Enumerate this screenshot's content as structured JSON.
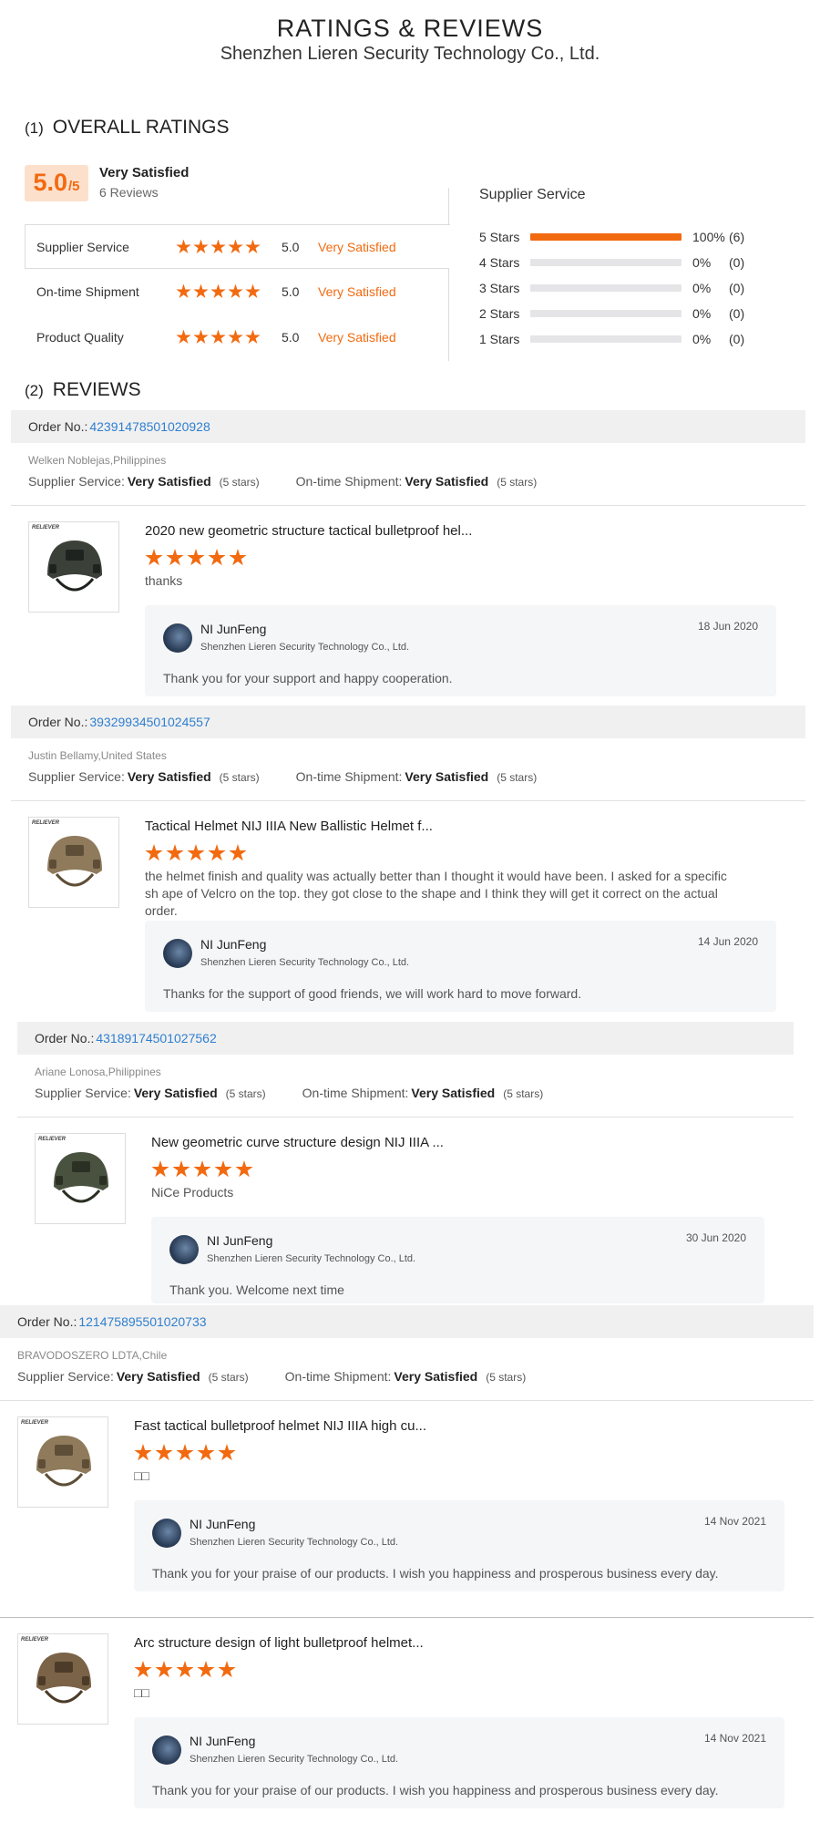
{
  "page": {
    "title": "RATINGS & REVIEWS",
    "company": "Shenzhen Lieren Security Technology Co., Ltd."
  },
  "overall": {
    "section_num": "(1)",
    "section_label": "OVERALL RATINGS",
    "score": "5.0",
    "score_max": "/5",
    "label": "Very Satisfied",
    "review_count": "6 Reviews",
    "categories": [
      {
        "name": "Supplier Service",
        "stars": 5,
        "value": "5.0",
        "label": "Very Satisfied"
      },
      {
        "name": "On-time Shipment",
        "stars": 5,
        "value": "5.0",
        "label": "Very Satisfied"
      },
      {
        "name": "Product Quality",
        "stars": 5,
        "value": "5.0",
        "label": "Very Satisfied"
      }
    ],
    "distribution_title": "Supplier Service",
    "distribution": [
      {
        "label": "5  Stars",
        "percent": 100,
        "percent_text": "100%",
        "count": "(6)"
      },
      {
        "label": "4  Stars",
        "percent": 0,
        "percent_text": "0%",
        "count": "(0)"
      },
      {
        "label": "3  Stars",
        "percent": 0,
        "percent_text": "0%",
        "count": "(0)"
      },
      {
        "label": "2  Stars",
        "percent": 0,
        "percent_text": "0%",
        "count": "(0)"
      },
      {
        "label": "1  Stars",
        "percent": 0,
        "percent_text": "0%",
        "count": "(0)"
      }
    ],
    "accent_color": "#f26a10"
  },
  "reviews_section": {
    "section_num": "(2)",
    "section_label": "REVIEWS"
  },
  "labels": {
    "order_no": "Order No.:",
    "supplier_service": "Supplier Service:",
    "ontime_shipment": "On-time Shipment:",
    "very_satisfied": "Very Satisfied",
    "five_stars": "(5 stars)"
  },
  "orders": [
    {
      "order_number": "42391478501020928",
      "buyer": "Welken Noblejas,Philippines",
      "reviews": [
        {
          "product_title": "2020 new geometric structure tactical bulletproof hel...",
          "stars": 5,
          "comment": "thanks",
          "thumb_icon": "helmet-black-icon",
          "reply": {
            "name": "NI JunFeng",
            "company": "Shenzhen Lieren Security Technology Co., Ltd.",
            "date": "18 Jun 2020",
            "text": "Thank you for your support and happy cooperation."
          }
        }
      ]
    },
    {
      "order_number": "39329934501024557",
      "buyer": "Justin Bellamy,United States",
      "reviews": [
        {
          "product_title": "Tactical Helmet NIJ IIIA New Ballistic Helmet f...",
          "stars": 5,
          "comment": "the helmet finish and quality was actually better than I thought it would have been. I asked for a specific sh ape of Velcro on the top. they got close to the shape and I think they will get it correct on the actual order.",
          "thumb_icon": "helmet-tan-icon",
          "reply": {
            "name": "NI JunFeng",
            "company": "Shenzhen Lieren Security Technology Co., Ltd.",
            "date": "14 Jun 2020",
            "text": "Thanks for the support of good friends, we will work hard to move forward."
          }
        }
      ]
    },
    {
      "order_number": "43189174501027562",
      "buyer": "Ariane Lonosa,Philippines",
      "reviews": [
        {
          "product_title": "New geometric curve structure design NIJ IIIA ...",
          "stars": 5,
          "comment": "NiCe Products",
          "thumb_icon": "helmet-green-icon",
          "reply": {
            "name": "NI JunFeng",
            "company": "Shenzhen Lieren Security Technology Co., Ltd.",
            "date": "30 Jun 2020",
            "text": "Thank you. Welcome next time"
          }
        }
      ]
    },
    {
      "order_number": "121475895501020733",
      "buyer": "BRAVODOSZERO LDTA,Chile",
      "reviews": [
        {
          "product_title": "Fast tactical bulletproof helmet NIJ IIIA high cu...",
          "stars": 5,
          "comment": "□□",
          "thumb_icon": "helmet-tan-icon",
          "reply": {
            "name": "NI JunFeng",
            "company": "Shenzhen Lieren Security Technology Co., Ltd.",
            "date": "14 Nov 2021",
            "text": "Thank you for your praise of our products. I wish you happiness and prosperous business every day."
          }
        },
        {
          "product_title": "Arc structure design of light bulletproof helmet...",
          "stars": 5,
          "comment": "□□",
          "thumb_icon": "helmet-brown-icon",
          "reply": {
            "name": "NI JunFeng",
            "company": "Shenzhen Lieren Security Technology Co., Ltd.",
            "date": "14 Nov 2021",
            "text": "Thank you for your praise of our products. I wish you happiness and prosperous business every day."
          }
        }
      ]
    }
  ]
}
